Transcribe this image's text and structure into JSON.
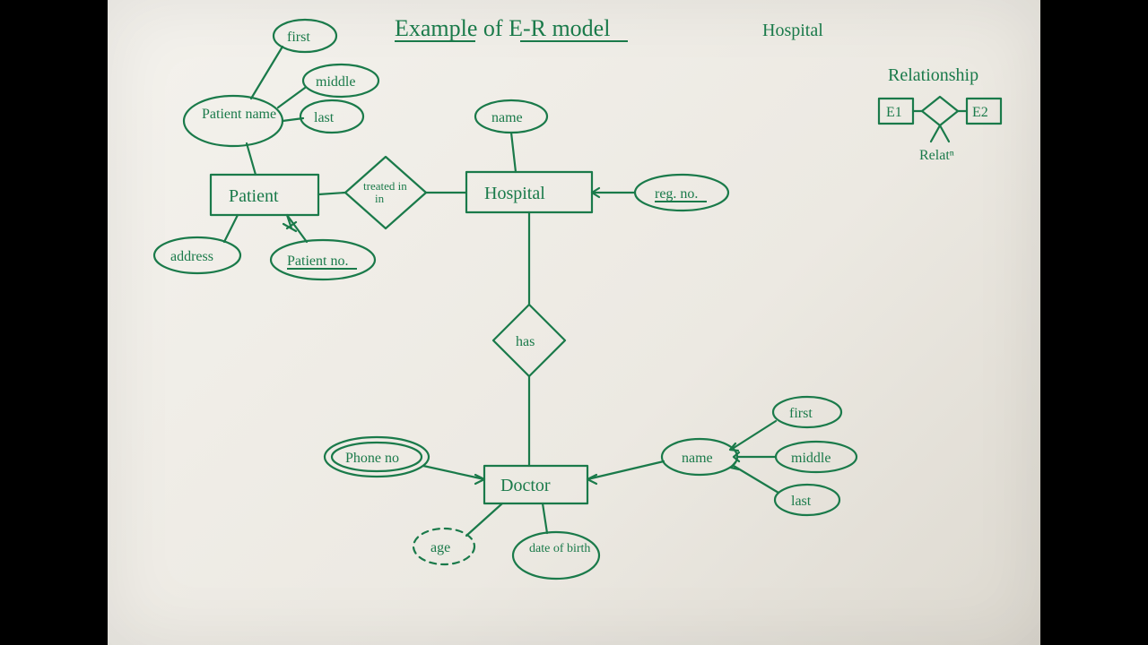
{
  "title": "Example of E-R model",
  "corner_label": "Hospital",
  "legend": {
    "title": "Relationship",
    "e1": "E1",
    "e2": "E2",
    "relat": "Relatⁿ"
  },
  "entities": {
    "patient": "Patient",
    "hospital": "Hospital",
    "doctor": "Doctor"
  },
  "relationships": {
    "treated_in": "treated in",
    "has": "has"
  },
  "attributes": {
    "patient_name": "Patient name",
    "first": "first",
    "middle": "middle",
    "last": "last",
    "address": "address",
    "patient_no": "Patient no.",
    "name": "name",
    "reg_no": "reg. no.",
    "phone_no": "Phone no",
    "age": "age",
    "date_of_birth": "date of birth",
    "doc_name": "name",
    "doc_first": "first",
    "doc_middle": "middle",
    "doc_last": "last"
  }
}
